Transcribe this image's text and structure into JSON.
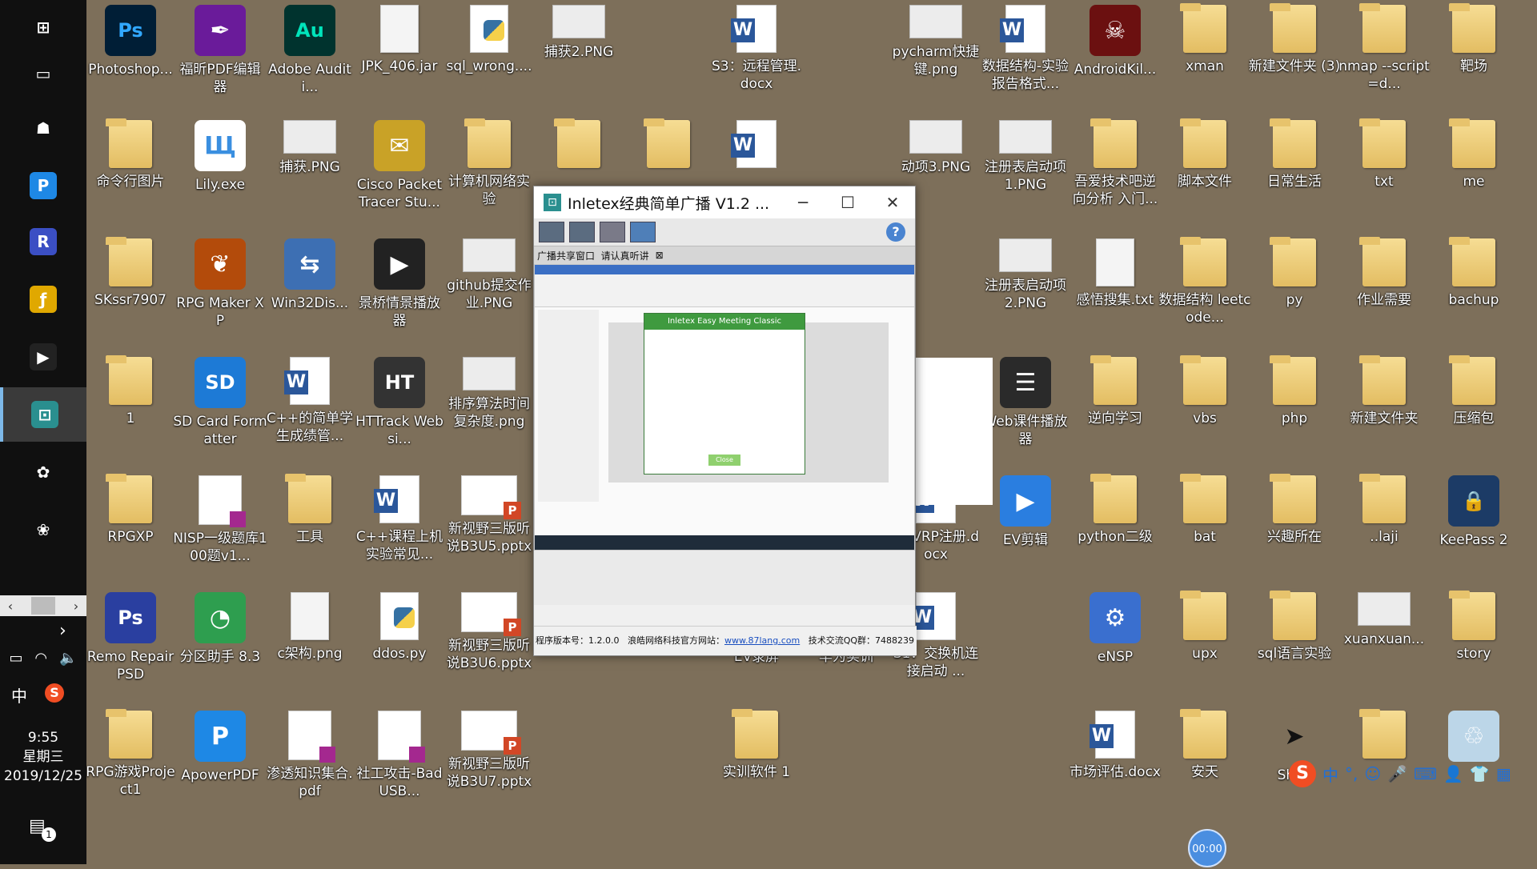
{
  "taskbar": {
    "clock_time": "9:55",
    "clock_weekday": "星期三",
    "clock_date": "2019/12/25",
    "ime_lang": "中",
    "ime_brand": "S",
    "notification_count": "1",
    "pinned": [
      {
        "name": "windows-start-icon",
        "glyph": "⊞",
        "color": "#101010"
      },
      {
        "name": "task-view-icon",
        "glyph": "▭",
        "color": "#101010"
      },
      {
        "name": "pinned-app-1-icon",
        "glyph": "☗",
        "color": "#101010"
      },
      {
        "name": "apowerpdf-icon",
        "glyph": "P",
        "color": "#1e88e5"
      },
      {
        "name": "pinned-app-3-icon",
        "glyph": "R",
        "color": "#3b4fc4"
      },
      {
        "name": "pinned-app-4-icon",
        "glyph": "ƒ",
        "color": "#e0a800"
      },
      {
        "name": "media-player-icon",
        "glyph": "▶",
        "color": "#222"
      },
      {
        "name": "inletex-icon",
        "glyph": "⊡",
        "color": "#2a8f8f"
      },
      {
        "name": "pinned-app-6-icon",
        "glyph": "✿",
        "color": "#101010"
      },
      {
        "name": "pinned-app-7-icon",
        "glyph": "❀",
        "color": "#101010"
      }
    ]
  },
  "desktop": {
    "icons": [
      {
        "label": "Photoshop...",
        "kind": "ps"
      },
      {
        "label": "福昕PDF编辑器",
        "kind": "foxit"
      },
      {
        "label": "Adobe Auditi...",
        "kind": "au"
      },
      {
        "label": "JPK_406.jar",
        "kind": "file"
      },
      {
        "label": "sql_wrong....",
        "kind": "py"
      },
      {
        "label": "捕获2.PNG",
        "kind": "png"
      },
      {
        "label": "S3：远程管理.docx",
        "kind": "word"
      },
      {
        "label": "pycharm快捷键.png",
        "kind": "png"
      },
      {
        "label": "数据结构-实验报告格式...",
        "kind": "word"
      },
      {
        "label": "AndroidKil...",
        "kind": "android"
      },
      {
        "label": "xman",
        "kind": "folder"
      },
      {
        "label": "新建文件夹 (3)",
        "kind": "folder"
      },
      {
        "label": "nmap --script=d...",
        "kind": "folder"
      },
      {
        "label": "靶场",
        "kind": "folder"
      },
      {
        "label": "命令行图片",
        "kind": "folder"
      },
      {
        "label": "Lily.exe",
        "kind": "lily"
      },
      {
        "label": "捕获.PNG",
        "kind": "png"
      },
      {
        "label": "Cisco Packet Tracer Stu...",
        "kind": "cisco"
      },
      {
        "label": "计算机网络实验",
        "kind": "folder"
      },
      {
        "label": "",
        "kind": "folder"
      },
      {
        "label": "",
        "kind": "folder"
      },
      {
        "label": "",
        "kind": "word"
      },
      {
        "label": "动项3.PNG",
        "kind": "png"
      },
      {
        "label": "注册表启动项1.PNG",
        "kind": "png"
      },
      {
        "label": "吾爱技术吧逆向分析 入门...",
        "kind": "folder"
      },
      {
        "label": "脚本文件",
        "kind": "folder"
      },
      {
        "label": "日常生活",
        "kind": "folder"
      },
      {
        "label": "txt",
        "kind": "folder"
      },
      {
        "label": "me",
        "kind": "folder"
      },
      {
        "label": "SKssr7907",
        "kind": "folder"
      },
      {
        "label": "RPG Maker XP",
        "kind": "rpg"
      },
      {
        "label": "Win32Dis...",
        "kind": "win32"
      },
      {
        "label": "景桥情景播放器",
        "kind": "player"
      },
      {
        "label": "github提交作业.PNG",
        "kind": "png"
      },
      {
        "label": "注册表启动项2.PNG",
        "kind": "png"
      },
      {
        "label": "感悟搜集.txt",
        "kind": "file"
      },
      {
        "label": "数据结构 leetcode...",
        "kind": "folder"
      },
      {
        "label": "py",
        "kind": "folder"
      },
      {
        "label": "作业需要",
        "kind": "folder"
      },
      {
        "label": "bachup",
        "kind": "folder"
      },
      {
        "label": "1",
        "kind": "folder"
      },
      {
        "label": "SD Card Formatter",
        "kind": "sd"
      },
      {
        "label": "C++的简单学生成绩管...",
        "kind": "word"
      },
      {
        "label": "HTTrack Websi...",
        "kind": "httrack"
      },
      {
        "label": "排序算法时间复杂度.png",
        "kind": "png"
      },
      {
        "label": "Web课件播放器",
        "kind": "web"
      },
      {
        "label": "逆向学习",
        "kind": "folder"
      },
      {
        "label": "vbs",
        "kind": "folder"
      },
      {
        "label": "php",
        "kind": "folder"
      },
      {
        "label": "新建文件夹",
        "kind": "folder"
      },
      {
        "label": "压缩包",
        "kind": "folder"
      },
      {
        "label": "RPGXP",
        "kind": "folder"
      },
      {
        "label": "NISP一级题库100题v1...",
        "kind": "pdf"
      },
      {
        "label": "工具",
        "kind": "folder"
      },
      {
        "label": "C++课程上机实验常见...",
        "kind": "word"
      },
      {
        "label": "新视野三版听说B3U5.pptx",
        "kind": "ppt"
      },
      {
        "label": ": GVRP注册.docx",
        "kind": "word"
      },
      {
        "label": "EV剪辑",
        "kind": "ev"
      },
      {
        "label": "python二级",
        "kind": "folder"
      },
      {
        "label": "bat",
        "kind": "folder"
      },
      {
        "label": "兴趣所在",
        "kind": "folder"
      },
      {
        "label": "..laji",
        "kind": "folder"
      },
      {
        "label": "KeePass 2",
        "kind": "keepass"
      },
      {
        "label": "Remo Repair PSD",
        "kind": "remo"
      },
      {
        "label": "分区助手 8.3",
        "kind": "partition"
      },
      {
        "label": "c架构.png",
        "kind": "file"
      },
      {
        "label": "ddos.py",
        "kind": "py"
      },
      {
        "label": "新视野三版听说B3U6.pptx",
        "kind": "ppt"
      },
      {
        "label": "EV录屏",
        "kind": "none"
      },
      {
        "label": "华为实训",
        "kind": "none"
      },
      {
        "label": "S1：交换机连接启动 ...",
        "kind": "word"
      },
      {
        "label": "eNSP",
        "kind": "ensp"
      },
      {
        "label": "upx",
        "kind": "folder"
      },
      {
        "label": "sql语言实验",
        "kind": "folder"
      },
      {
        "label": "xuanxuan...",
        "kind": "png"
      },
      {
        "label": "story",
        "kind": "folder"
      },
      {
        "label": "RPG游戏Project1",
        "kind": "folder"
      },
      {
        "label": "ApowerPDF",
        "kind": "apower"
      },
      {
        "label": "渗透知识集合.pdf",
        "kind": "pdf"
      },
      {
        "label": "社工攻击-BadUSB...",
        "kind": "pdf"
      },
      {
        "label": "新视野三版听说B3U7.pptx",
        "kind": "ppt"
      },
      {
        "label": "实训软件 1",
        "kind": "folder"
      },
      {
        "label": "市场评估.docx",
        "kind": "word"
      },
      {
        "label": "安天",
        "kind": "folder"
      },
      {
        "label": "Shad",
        "kind": "shadow"
      },
      {
        "label": "",
        "kind": "folder"
      },
      {
        "label": "",
        "kind": "recycle"
      }
    ]
  },
  "window": {
    "title": "Inletex经典简单广播 V1.2 ...",
    "tab_label": "广播共享窗口",
    "tab_note": "请认真听讲",
    "tab_close": "⊠",
    "help": "?",
    "minimize": "─",
    "maximize": "☐",
    "close": "✕",
    "dialog_title": "Inletex Easy Meeting Classic",
    "dialog_ok": "Close",
    "status_version": "程序版本号：1.2.0.0",
    "status_site_label": "浪皓网络科技官方网站：",
    "status_site": "www.87lang.com",
    "status_qq": "技术交流QQ群：7488239"
  },
  "sogou": {
    "logo": "S",
    "items": [
      "中",
      "°,",
      "☺",
      "🎤",
      "⌨",
      "👤",
      "👕",
      "▦"
    ]
  },
  "timer": "00:00"
}
